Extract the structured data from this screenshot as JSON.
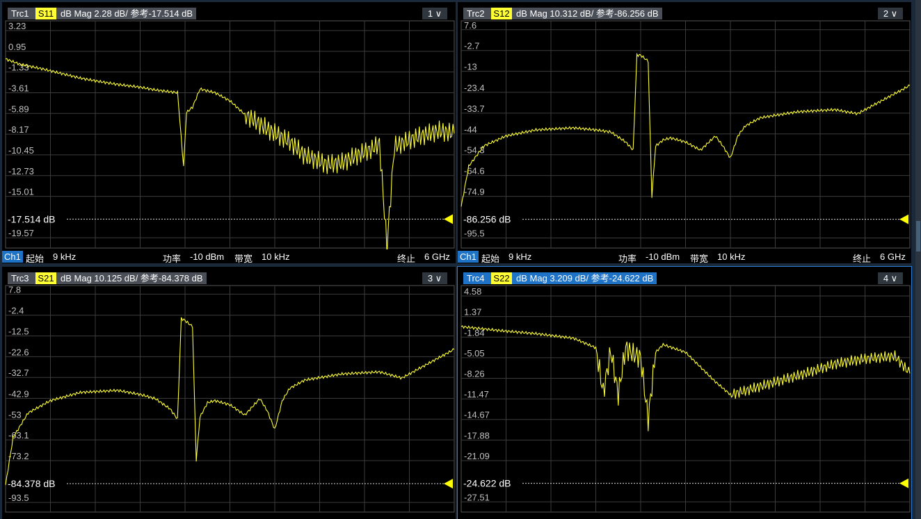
{
  "channel_label": "Ch1",
  "footer": {
    "start_label": "起始",
    "start_val": "9 kHz",
    "power_label": "功率",
    "power_val": "-10 dBm",
    "bw_label": "带宽",
    "bw_val": "10 kHz",
    "stop_label": "终止",
    "stop_val": "6 GHz"
  },
  "colors": {
    "trace": "#ffff33",
    "grid": "#3c3c3c",
    "axis_text": "#c0c0c0",
    "ref_marker": "#ffff00"
  },
  "chart_data": [
    {
      "type": "line",
      "trace": "Trc1",
      "param": "S11",
      "format": "dB Mag 2.28 dB/ 参考-17.514 dB",
      "dropdown": "1",
      "ref_label": "-17.514 dB",
      "ref_value": -17.514,
      "ylim": [
        -20.7,
        4.3
      ],
      "xlim": [
        0,
        6
      ],
      "yticks": [
        "3.23",
        "0.95",
        "-1.33",
        "-3.61",
        "-5.89",
        "-8.17",
        "-10.45",
        "-12.73",
        "-15.01",
        "-19.57"
      ],
      "ytick_values": [
        3.23,
        0.95,
        -1.33,
        -3.61,
        -5.89,
        -8.17,
        -10.45,
        -12.73,
        -15.01,
        -19.57
      ],
      "x": [
        0,
        0.2,
        0.5,
        0.8,
        1.0,
        1.2,
        1.5,
        1.8,
        2.0,
        2.3,
        2.38,
        2.42,
        2.5,
        2.6,
        2.8,
        3.0,
        3.2,
        3.5,
        3.8,
        4.0,
        4.3,
        4.5,
        4.7,
        4.9,
        5.0,
        5.1,
        5.2,
        5.5,
        5.8,
        6.0
      ],
      "y": [
        0.1,
        -0.5,
        -1.0,
        -1.6,
        -2.0,
        -2.3,
        -2.7,
        -3.0,
        -3.3,
        -3.6,
        -11.7,
        -5.8,
        -5.2,
        -3.2,
        -3.6,
        -4.5,
        -6.0,
        -7.6,
        -9.0,
        -10.5,
        -11.5,
        -11.3,
        -10.5,
        -9.8,
        -9.2,
        -20.6,
        -9.5,
        -8.5,
        -7.8,
        -8.1
      ]
    },
    {
      "type": "line",
      "trace": "Trc2",
      "param": "S12",
      "format": "dB Mag 10.312 dB/ 参考-86.256 dB",
      "dropdown": "2",
      "ref_label": "-86.256 dB",
      "ref_value": -86.256,
      "ylim": [
        -100.5,
        12.0
      ],
      "xlim": [
        0,
        6
      ],
      "yticks": [
        "7.6",
        "-2.7",
        "-13",
        "-23.4",
        "-33.7",
        "-44",
        "-54.3",
        "-64.6",
        "-74.9",
        "-95.5"
      ],
      "ytick_values": [
        7.6,
        -2.7,
        -13,
        -23.4,
        -33.7,
        -44,
        -54.3,
        -64.6,
        -74.9,
        -95.5
      ],
      "x": [
        0,
        0.1,
        0.3,
        0.6,
        1.0,
        1.5,
        1.8,
        2.0,
        2.2,
        2.3,
        2.35,
        2.4,
        2.5,
        2.55,
        2.6,
        2.7,
        2.8,
        3.0,
        3.2,
        3.4,
        3.5,
        3.6,
        3.7,
        3.8,
        4.0,
        4.5,
        5.0,
        5.3,
        5.6,
        6.0
      ],
      "y": [
        -80,
        -60,
        -50,
        -45,
        -42,
        -41,
        -42,
        -43,
        -48,
        -52,
        -5,
        -5,
        -8,
        -75,
        -50,
        -47,
        -46,
        -48,
        -52,
        -45,
        -50,
        -56,
        -45,
        -40,
        -36,
        -33,
        -32,
        -34,
        -28,
        -20
      ]
    },
    {
      "type": "line",
      "trace": "Trc3",
      "param": "S21",
      "format": "dB Mag 10.125 dB/ 参考-84.378 dB",
      "dropdown": "3",
      "ref_label": "-84.378 dB",
      "ref_value": -84.378,
      "ylim": [
        -98.2,
        12.0
      ],
      "xlim": [
        0,
        6
      ],
      "yticks": [
        "7.8",
        "-2.4",
        "-12.5",
        "-22.6",
        "-32.7",
        "-42.9",
        "-53",
        "-63.1",
        "-73.2",
        "-93.5"
      ],
      "ytick_values": [
        7.8,
        -2.4,
        -12.5,
        -22.6,
        -32.7,
        -42.9,
        -53,
        -63.1,
        -73.2,
        -93.5
      ],
      "x": [
        0,
        0.1,
        0.3,
        0.6,
        1.0,
        1.5,
        1.8,
        2.0,
        2.2,
        2.3,
        2.35,
        2.4,
        2.5,
        2.55,
        2.6,
        2.7,
        2.8,
        3.0,
        3.2,
        3.4,
        3.5,
        3.6,
        3.7,
        3.8,
        4.0,
        4.5,
        5.0,
        5.3,
        5.6,
        6.0
      ],
      "y": [
        -85,
        -62,
        -50,
        -44,
        -40,
        -39,
        -41,
        -43,
        -48,
        -53,
        -4,
        -5,
        -8,
        -73,
        -52,
        -45,
        -44,
        -46,
        -51,
        -43,
        -49,
        -58,
        -44,
        -38,
        -34,
        -31,
        -30,
        -33,
        -27,
        -19
      ]
    },
    {
      "type": "line",
      "trace": "Trc4",
      "param": "S22",
      "format": "dB Mag 3.209 dB/ 参考-24.622 dB",
      "dropdown": "4",
      "ref_label": "-24.622 dB",
      "ref_value": -24.622,
      "active": true,
      "ylim": [
        -29.1,
        6.2
      ],
      "xlim": [
        0,
        6
      ],
      "yticks": [
        "4.58",
        "1.37",
        "-1.84",
        "-5.05",
        "-8.26",
        "-11.47",
        "-14.67",
        "-17.88",
        "-21.09",
        "-27.51"
      ],
      "ytick_values": [
        4.58,
        1.37,
        -1.84,
        -5.05,
        -8.26,
        -11.47,
        -14.67,
        -17.88,
        -21.09,
        -27.51
      ],
      "x": [
        0,
        0.5,
        1.0,
        1.5,
        1.8,
        1.9,
        2.0,
        2.1,
        2.2,
        2.3,
        2.4,
        2.5,
        2.6,
        2.7,
        2.8,
        3.0,
        3.2,
        3.4,
        3.6,
        3.8,
        4.0,
        4.3,
        4.6,
        5.0,
        5.4,
        5.8,
        6.0
      ],
      "y": [
        -0.2,
        -0.8,
        -1.3,
        -2.0,
        -3.5,
        -10.5,
        -4.0,
        -10.8,
        -3.5,
        -4.5,
        -5.0,
        -14.8,
        -4.2,
        -3.0,
        -3.4,
        -4.2,
        -6.5,
        -8.8,
        -10.8,
        -10.2,
        -9.5,
        -8.5,
        -7.5,
        -6.0,
        -5.2,
        -4.8,
        -7.5
      ]
    }
  ]
}
